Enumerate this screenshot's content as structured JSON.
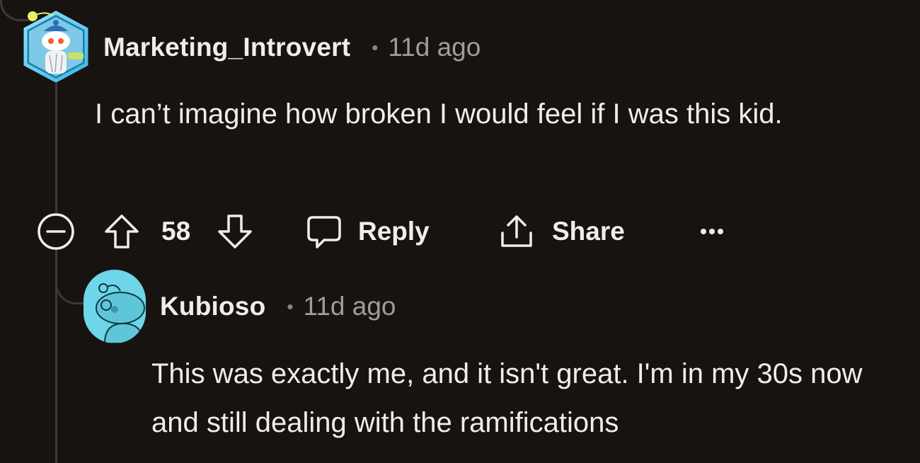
{
  "comments": [
    {
      "username": "Marketing_Introvert",
      "separator": "•",
      "timestamp": "11d ago",
      "body": "I can’t imagine how broken I would feel if I was this kid.",
      "avatar": "snoo-hexagon-avatar-icon",
      "actions": {
        "score": "58",
        "reply_label": "Reply",
        "share_label": "Share"
      }
    },
    {
      "username": "Kubioso",
      "separator": "•",
      "timestamp": "11d ago",
      "body": "This was exactly me, and it isn't great. I'm in my 30s now and still dealing with the ramifications",
      "avatar": "snoo-default-avatar-icon"
    }
  ],
  "icons": {
    "collapse": "minus-circle-icon",
    "upvote": "arrow-up-icon",
    "downvote": "arrow-down-icon",
    "reply": "speech-bubble-icon",
    "share": "share-upload-icon",
    "more": "ellipsis-icon"
  },
  "colors": {
    "background": "#171311",
    "text": "#f1ede9",
    "muted": "#a39c97",
    "thread_line": "#3d3936",
    "avatar_reply_bg": "#6dd6e8"
  }
}
